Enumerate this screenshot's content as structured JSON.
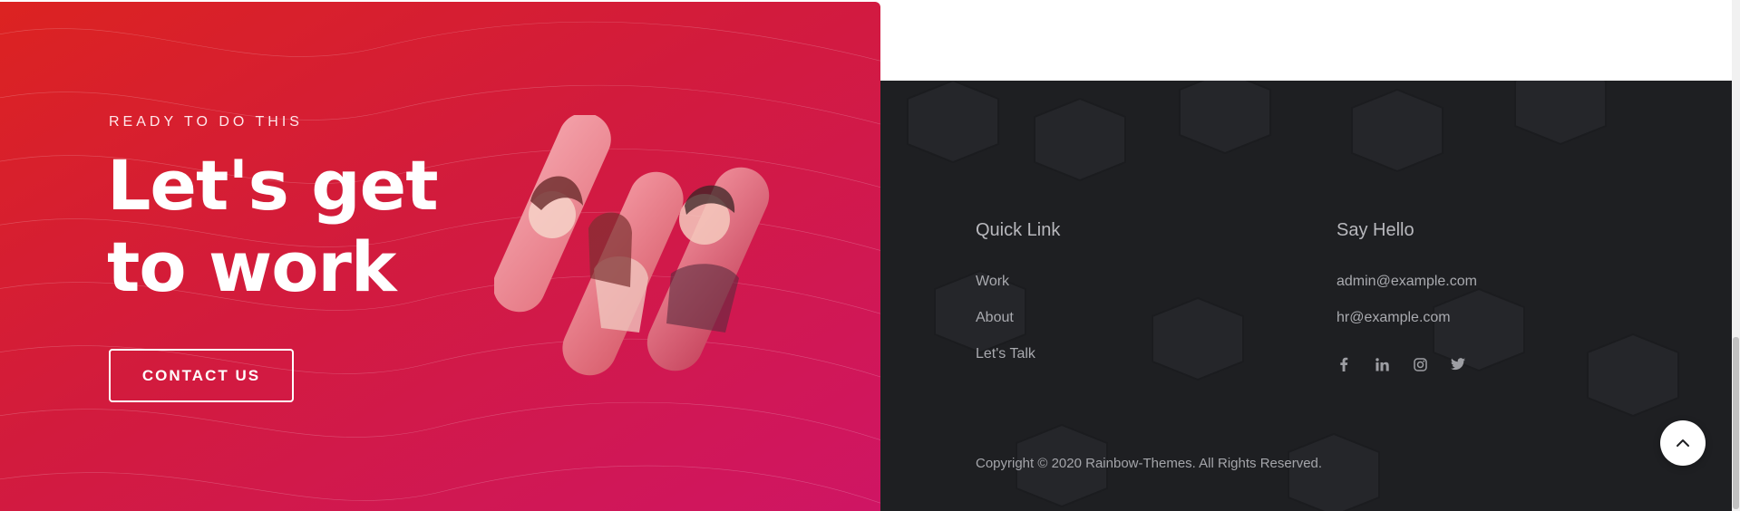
{
  "cta": {
    "eyebrow": "READY TO DO THIS",
    "title_line1": "Let's get",
    "title_line2": "to work",
    "button_label": "CONTACT US",
    "gradient_start": "#dc2321",
    "gradient_end": "#cf1564"
  },
  "footer": {
    "background": "#1e1f22",
    "quick_link": {
      "title": "Quick Link",
      "items": [
        "Work",
        "About",
        "Let's Talk"
      ]
    },
    "say_hello": {
      "title": "Say Hello",
      "emails": [
        "admin@example.com",
        "hr@example.com"
      ]
    },
    "socials": [
      "facebook-icon",
      "linkedin-icon",
      "instagram-icon",
      "twitter-icon"
    ],
    "copyright": "Copyright © 2020 Rainbow-Themes. All Rights Reserved."
  },
  "scroll_top": {
    "icon": "chevron-up-icon"
  }
}
